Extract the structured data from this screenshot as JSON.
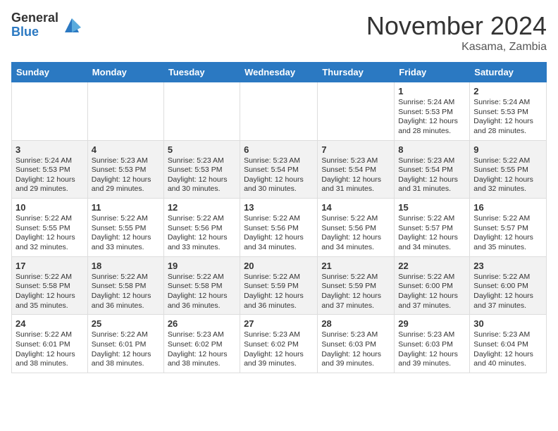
{
  "header": {
    "logo_general": "General",
    "logo_blue": "Blue",
    "month_title": "November 2024",
    "location": "Kasama, Zambia"
  },
  "days_of_week": [
    "Sunday",
    "Monday",
    "Tuesday",
    "Wednesday",
    "Thursday",
    "Friday",
    "Saturday"
  ],
  "weeks": [
    [
      {
        "day": "",
        "text": ""
      },
      {
        "day": "",
        "text": ""
      },
      {
        "day": "",
        "text": ""
      },
      {
        "day": "",
        "text": ""
      },
      {
        "day": "",
        "text": ""
      },
      {
        "day": "1",
        "text": "Sunrise: 5:24 AM\nSunset: 5:53 PM\nDaylight: 12 hours and 28 minutes."
      },
      {
        "day": "2",
        "text": "Sunrise: 5:24 AM\nSunset: 5:53 PM\nDaylight: 12 hours and 28 minutes."
      }
    ],
    [
      {
        "day": "3",
        "text": "Sunrise: 5:24 AM\nSunset: 5:53 PM\nDaylight: 12 hours and 29 minutes."
      },
      {
        "day": "4",
        "text": "Sunrise: 5:23 AM\nSunset: 5:53 PM\nDaylight: 12 hours and 29 minutes."
      },
      {
        "day": "5",
        "text": "Sunrise: 5:23 AM\nSunset: 5:53 PM\nDaylight: 12 hours and 30 minutes."
      },
      {
        "day": "6",
        "text": "Sunrise: 5:23 AM\nSunset: 5:54 PM\nDaylight: 12 hours and 30 minutes."
      },
      {
        "day": "7",
        "text": "Sunrise: 5:23 AM\nSunset: 5:54 PM\nDaylight: 12 hours and 31 minutes."
      },
      {
        "day": "8",
        "text": "Sunrise: 5:23 AM\nSunset: 5:54 PM\nDaylight: 12 hours and 31 minutes."
      },
      {
        "day": "9",
        "text": "Sunrise: 5:22 AM\nSunset: 5:55 PM\nDaylight: 12 hours and 32 minutes."
      }
    ],
    [
      {
        "day": "10",
        "text": "Sunrise: 5:22 AM\nSunset: 5:55 PM\nDaylight: 12 hours and 32 minutes."
      },
      {
        "day": "11",
        "text": "Sunrise: 5:22 AM\nSunset: 5:55 PM\nDaylight: 12 hours and 33 minutes."
      },
      {
        "day": "12",
        "text": "Sunrise: 5:22 AM\nSunset: 5:56 PM\nDaylight: 12 hours and 33 minutes."
      },
      {
        "day": "13",
        "text": "Sunrise: 5:22 AM\nSunset: 5:56 PM\nDaylight: 12 hours and 34 minutes."
      },
      {
        "day": "14",
        "text": "Sunrise: 5:22 AM\nSunset: 5:56 PM\nDaylight: 12 hours and 34 minutes."
      },
      {
        "day": "15",
        "text": "Sunrise: 5:22 AM\nSunset: 5:57 PM\nDaylight: 12 hours and 34 minutes."
      },
      {
        "day": "16",
        "text": "Sunrise: 5:22 AM\nSunset: 5:57 PM\nDaylight: 12 hours and 35 minutes."
      }
    ],
    [
      {
        "day": "17",
        "text": "Sunrise: 5:22 AM\nSunset: 5:58 PM\nDaylight: 12 hours and 35 minutes."
      },
      {
        "day": "18",
        "text": "Sunrise: 5:22 AM\nSunset: 5:58 PM\nDaylight: 12 hours and 36 minutes."
      },
      {
        "day": "19",
        "text": "Sunrise: 5:22 AM\nSunset: 5:58 PM\nDaylight: 12 hours and 36 minutes."
      },
      {
        "day": "20",
        "text": "Sunrise: 5:22 AM\nSunset: 5:59 PM\nDaylight: 12 hours and 36 minutes."
      },
      {
        "day": "21",
        "text": "Sunrise: 5:22 AM\nSunset: 5:59 PM\nDaylight: 12 hours and 37 minutes."
      },
      {
        "day": "22",
        "text": "Sunrise: 5:22 AM\nSunset: 6:00 PM\nDaylight: 12 hours and 37 minutes."
      },
      {
        "day": "23",
        "text": "Sunrise: 5:22 AM\nSunset: 6:00 PM\nDaylight: 12 hours and 37 minutes."
      }
    ],
    [
      {
        "day": "24",
        "text": "Sunrise: 5:22 AM\nSunset: 6:01 PM\nDaylight: 12 hours and 38 minutes."
      },
      {
        "day": "25",
        "text": "Sunrise: 5:22 AM\nSunset: 6:01 PM\nDaylight: 12 hours and 38 minutes."
      },
      {
        "day": "26",
        "text": "Sunrise: 5:23 AM\nSunset: 6:02 PM\nDaylight: 12 hours and 38 minutes."
      },
      {
        "day": "27",
        "text": "Sunrise: 5:23 AM\nSunset: 6:02 PM\nDaylight: 12 hours and 39 minutes."
      },
      {
        "day": "28",
        "text": "Sunrise: 5:23 AM\nSunset: 6:03 PM\nDaylight: 12 hours and 39 minutes."
      },
      {
        "day": "29",
        "text": "Sunrise: 5:23 AM\nSunset: 6:03 PM\nDaylight: 12 hours and 39 minutes."
      },
      {
        "day": "30",
        "text": "Sunrise: 5:23 AM\nSunset: 6:04 PM\nDaylight: 12 hours and 40 minutes."
      }
    ]
  ]
}
